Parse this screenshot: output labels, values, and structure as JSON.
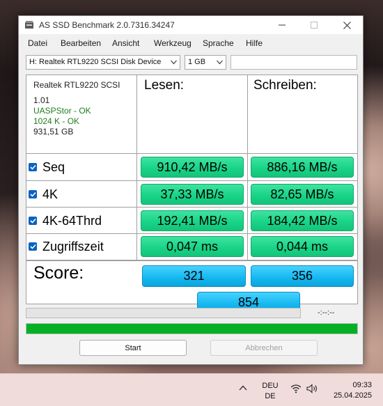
{
  "window": {
    "title": "AS SSD Benchmark 2.0.7316.34247",
    "icon": "ssd-app-icon"
  },
  "menu": [
    "Datei",
    "Bearbeiten",
    "Ansicht",
    "Werkzeug",
    "Sprache",
    "Hilfe"
  ],
  "toolbar": {
    "device": "H: Realtek RTL9220 SCSI Disk Device",
    "size": "1 GB",
    "extra_field": ""
  },
  "device_info": {
    "name": "Realtek RTL9220 SCSI",
    "firmware": "1.01",
    "driver": "UASPStor - OK",
    "alignment": "1024 K - OK",
    "capacity": "931,51 GB"
  },
  "columns": {
    "read": "Lesen:",
    "write": "Schreiben:"
  },
  "tests": [
    {
      "label": "Seq",
      "checked": true,
      "read": "910,42 MB/s",
      "write": "886,16 MB/s"
    },
    {
      "label": "4K",
      "checked": true,
      "read": "37,33 MB/s",
      "write": "82,65 MB/s"
    },
    {
      "label": "4K-64Thrd",
      "checked": true,
      "read": "192,41 MB/s",
      "write": "184,42 MB/s"
    },
    {
      "label": "Zugriffszeit",
      "checked": true,
      "read": "0,047 ms",
      "write": "0,044 ms"
    }
  ],
  "score": {
    "label": "Score:",
    "read": "321",
    "write": "356",
    "total": "854"
  },
  "progress": {
    "elapsed": "-:--:--",
    "fraction": 1.0
  },
  "buttons": {
    "start": "Start",
    "abort": "Abbrechen"
  },
  "taskbar": {
    "lang_line1": "DEU",
    "lang_line2": "DE",
    "time": "09:33",
    "date": "25.04.2025"
  },
  "colors": {
    "result_green": "#19d487",
    "score_blue": "#14b7f0",
    "progress_green": "#06b025",
    "ok_text_green": "#1e7d1e"
  }
}
